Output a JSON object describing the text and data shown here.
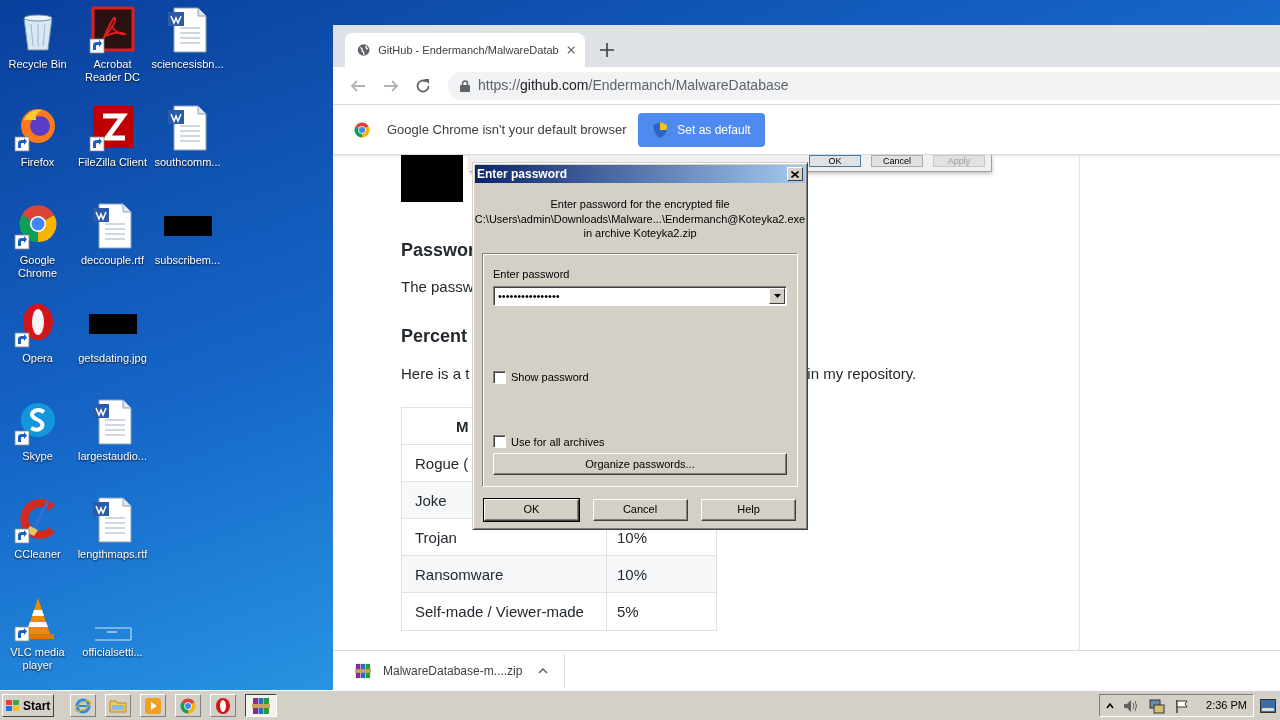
{
  "desktop_columns": [
    [
      {
        "label": "Recycle Bin",
        "kind": "recycle",
        "shortcut": false
      },
      {
        "label": "Firefox",
        "kind": "firefox",
        "shortcut": true
      },
      {
        "label": "Google Chrome",
        "kind": "chrome",
        "shortcut": true
      },
      {
        "label": "Opera",
        "kind": "opera",
        "shortcut": true
      },
      {
        "label": "Skype",
        "kind": "skype",
        "shortcut": true
      },
      {
        "label": "CCleaner",
        "kind": "ccleaner",
        "shortcut": true
      },
      {
        "label": "VLC media player",
        "kind": "vlc",
        "shortcut": true
      }
    ],
    [
      {
        "label": "Acrobat Reader DC",
        "kind": "acrobat",
        "shortcut": true
      },
      {
        "label": "FileZilla Client",
        "kind": "filezilla",
        "shortcut": true
      },
      {
        "label": "deccouple.rtf",
        "kind": "document",
        "shortcut": false
      },
      {
        "label": "getsdating.jpg",
        "kind": "redacted",
        "shortcut": false
      },
      {
        "label": "largestaudio...",
        "kind": "document",
        "shortcut": false
      },
      {
        "label": "lengthmaps.rtf",
        "kind": "document",
        "shortcut": false
      },
      {
        "label": "officialsetti...",
        "kind": "blank",
        "shortcut": false
      }
    ],
    [
      {
        "label": "sciencesisbn...",
        "kind": "document",
        "shortcut": false
      },
      {
        "label": "southcomm...",
        "kind": "document",
        "shortcut": false
      },
      {
        "label": "subscribem...",
        "kind": "redacted",
        "shortcut": false
      }
    ]
  ],
  "browser": {
    "tab": {
      "title": "GitHub - Endermanch/MalwareDatab",
      "selected": true
    },
    "url": {
      "scheme": "https://",
      "host": "github.com",
      "path": "/Endermanch/MalwareDatabase"
    },
    "infobar": {
      "message": "Google Chrome isn't your default browser",
      "button": "Set as default"
    },
    "page": {
      "heading_1": "Passwor",
      "paragraph_1": "The passw",
      "heading_2": "Percent",
      "paragraph_2_start": "Here is a t",
      "paragraph_2_end": "in my repository.",
      "table": {
        "header": "M",
        "rows": [
          {
            "cells": [
              "Rogue ("
            ]
          },
          {
            "cells": [
              "Joke"
            ]
          },
          {
            "cells": [
              "Trojan",
              "10%"
            ]
          },
          {
            "cells": [
              "Ransomware",
              "10%"
            ]
          },
          {
            "cells": [
              "Self-made / Viewer-made",
              "5%"
            ]
          }
        ]
      }
    },
    "download": {
      "file": "MalwareDatabase-m....zip"
    }
  },
  "background_window": {
    "buttons": [
      {
        "label": "OK",
        "disabled": false
      },
      {
        "label": "Cancel",
        "disabled": false
      },
      {
        "label": "Apply",
        "disabled": true
      }
    ]
  },
  "dialog": {
    "title": "Enter password",
    "message": [
      "Enter password for the encrypted file",
      "C:\\Users\\admin\\Downloads\\Malware...\\Endermanch@Koteyka2.exe",
      "in archive Koteyka2.zip"
    ],
    "group_label": "Enter password",
    "password": "••••••••••••••••",
    "checkboxes": [
      {
        "label": "Show password",
        "checked": false
      },
      {
        "label": "Use for all archives",
        "checked": false
      }
    ],
    "organize_button": "Organize passwords...",
    "buttons": [
      "OK",
      "Cancel",
      "Help"
    ]
  },
  "taskbar": {
    "start": "Start",
    "items": [
      {
        "kind": "ie",
        "selected": false
      },
      {
        "kind": "folder",
        "selected": false
      },
      {
        "kind": "media",
        "selected": false
      },
      {
        "kind": "chrome",
        "selected": false
      },
      {
        "kind": "opera",
        "selected": false
      },
      {
        "kind": "winrar",
        "selected": true
      }
    ],
    "clock": "2:36 PM"
  }
}
